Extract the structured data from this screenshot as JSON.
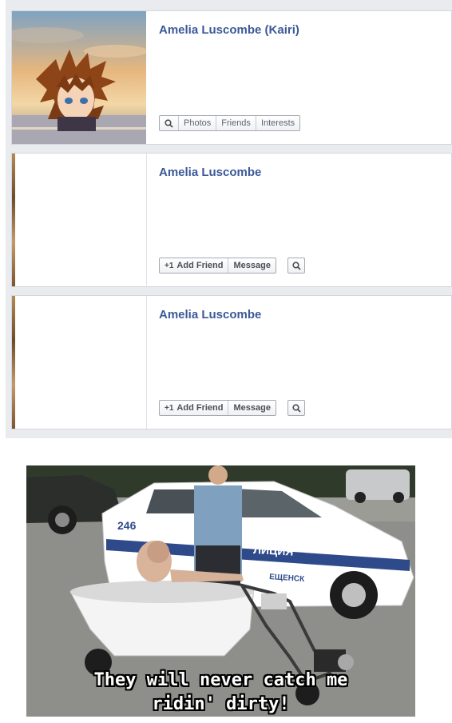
{
  "profiles": [
    {
      "name": "Amelia Luscombe (Kairi)",
      "photo_icon": "anime-character-avatar",
      "actions": [
        "Photos",
        "Friends",
        "Interests"
      ]
    },
    {
      "name": "Amelia Luscombe",
      "add_friend": "Add Friend",
      "add_friend_prefix": "+1",
      "message": "Message"
    },
    {
      "name": "Amelia Luscombe",
      "add_friend": "Add Friend",
      "add_friend_prefix": "+1",
      "message": "Message"
    }
  ],
  "meme": {
    "caption_line1": "They will never catch me",
    "caption_line2": "ridin' dirty!",
    "car_number": "246",
    "car_text": "ЛИЦИЯ",
    "car_text2": "ЕЩЕНСК"
  },
  "colors": {
    "link": "#3b5998",
    "panel": "#e9ebee"
  }
}
